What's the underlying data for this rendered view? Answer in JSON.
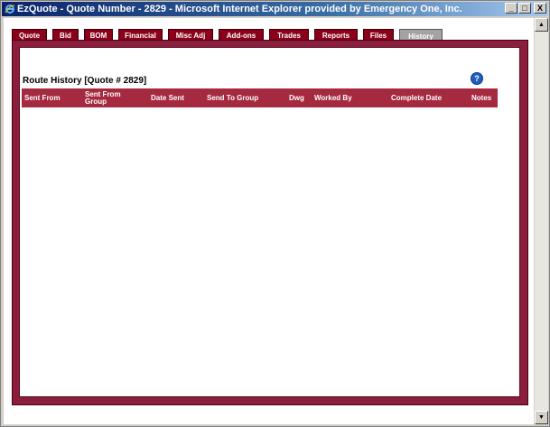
{
  "window": {
    "title": "EzQuote - Quote Number - 2829 - Microsoft Internet Explorer provided by Emergency One, Inc.",
    "controls": {
      "minimize": "_",
      "maximize": "□",
      "close": "X"
    }
  },
  "tabs": [
    "Quote",
    "Bid",
    "BOM",
    "Financial",
    "Misc Adj",
    "Add-ons",
    "Trades",
    "Reports",
    "Files",
    "History"
  ],
  "active_tab": "History",
  "section": {
    "title": "Route History [Quote # 2829]",
    "help_label": "?"
  },
  "table": {
    "columns": [
      "Sent From",
      "Sent From Group",
      "Date Sent",
      "Send To Group",
      "Dwg",
      "Worked By",
      "Complete Date",
      "Notes"
    ],
    "rows": []
  },
  "colors": {
    "tab": "#8b0019",
    "frame": "#8b1e3c",
    "header": "#a52a3f",
    "active_tab": "#a3a3a3"
  },
  "icons": {
    "browser": "ie-icon",
    "help": "help-icon"
  }
}
